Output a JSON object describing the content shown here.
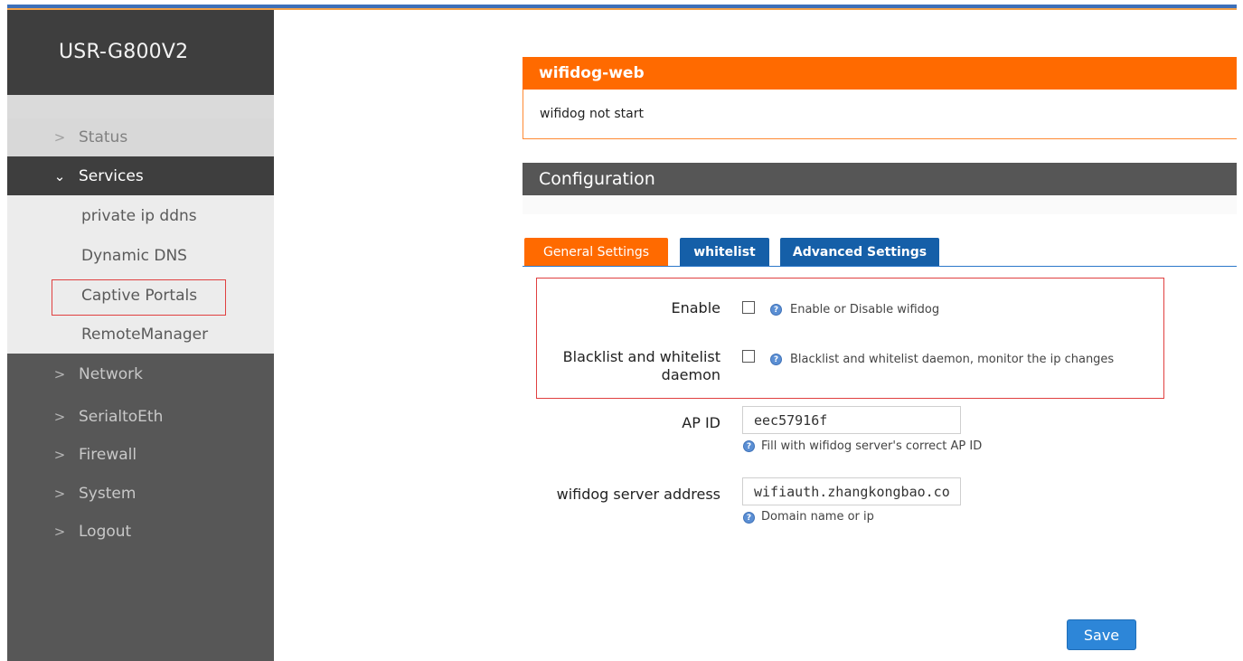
{
  "sidebar": {
    "brand": "USR-G800V2",
    "items": [
      {
        "label": "Status",
        "chevron": ">"
      },
      {
        "label": "Services",
        "chevron": "v"
      },
      {
        "label": "Network",
        "chevron": ">"
      },
      {
        "label": "SerialtoEth",
        "chevron": ">"
      },
      {
        "label": "Firewall",
        "chevron": ">"
      },
      {
        "label": "System",
        "chevron": ">"
      },
      {
        "label": "Logout",
        "chevron": ">"
      }
    ],
    "sub_items": [
      {
        "label": "private ip ddns"
      },
      {
        "label": "Dynamic DNS"
      },
      {
        "label": "Captive Portals"
      },
      {
        "label": "RemoteManager"
      }
    ]
  },
  "status_panel": {
    "title": "wifidog-web",
    "message": "wifidog not start"
  },
  "config": {
    "title": "Configuration",
    "tabs": [
      {
        "label": "General Settings",
        "active": true
      },
      {
        "label": "whitelist",
        "active": false
      },
      {
        "label": "Advanced Settings",
        "active": false
      }
    ],
    "enable": {
      "label": "Enable",
      "hint": "Enable or Disable wifidog",
      "checked": false
    },
    "daemon": {
      "label_line1": "Blacklist and whitelist",
      "label_line2": "daemon",
      "hint": "Blacklist and whitelist daemon, monitor the ip changes",
      "checked": false
    },
    "ap_id": {
      "label": "AP ID",
      "value": "eec57916f",
      "hint": "Fill with wifidog server's correct AP ID"
    },
    "server": {
      "label": "wifidog server address",
      "value": "wifiauth.zhangkongbao.co",
      "hint": "Domain name or ip"
    },
    "save_label": "Save"
  },
  "colors": {
    "accent_orange": "#ff6a00",
    "tab_blue": "#155fa8",
    "sidebar_dark": "#3e3e3e",
    "sidebar_mid": "#575757",
    "button_blue": "#2d86d8",
    "annotation_red": "#e04040"
  },
  "icons": {
    "help": "help-circle-icon",
    "chevron_right": "chevron-right-icon",
    "chevron_down": "chevron-down-icon"
  }
}
